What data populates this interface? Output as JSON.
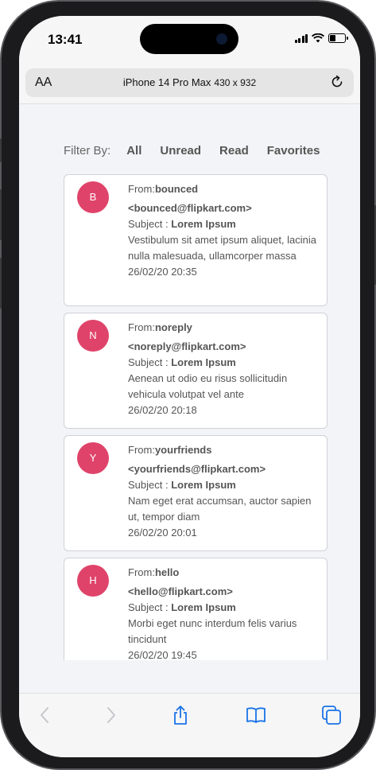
{
  "status": {
    "time": "13:41"
  },
  "browser": {
    "text_size_label": "AA",
    "device_name": "iPhone 14 Pro Max",
    "device_dims": "430 x 932"
  },
  "filter": {
    "label": "Filter By:",
    "options": [
      "All",
      "Unread",
      "Read",
      "Favorites"
    ]
  },
  "emails": [
    {
      "initial": "B",
      "from_prefix": "From:",
      "from_name": "bounced",
      "from_email": "<bounced@flipkart.com>",
      "subject_prefix": "Subject : ",
      "subject": "Lorem Ipsum",
      "body": "Vestibulum sit amet ipsum aliquet, lacinia nulla malesuada, ullamcorper massa",
      "date": "26/02/20 20:35"
    },
    {
      "initial": "N",
      "from_prefix": "From:",
      "from_name": "noreply",
      "from_email": "<noreply@flipkart.com>",
      "subject_prefix": "Subject : ",
      "subject": "Lorem Ipsum",
      "body": "Aenean ut odio eu risus sollicitudin vehicula volutpat vel ante",
      "date": "26/02/20 20:18"
    },
    {
      "initial": "Y",
      "from_prefix": "From:",
      "from_name": "yourfriends",
      "from_email": "<yourfriends@flipkart.com>",
      "subject_prefix": "Subject : ",
      "subject": "Lorem Ipsum",
      "body": "Nam eget erat accumsan, auctor sapien ut, tempor diam",
      "date": "26/02/20 20:01"
    },
    {
      "initial": "H",
      "from_prefix": "From:",
      "from_name": "hello",
      "from_email": "<hello@flipkart.com>",
      "subject_prefix": "Subject : ",
      "subject": "Lorem Ipsum",
      "body": "Morbi eget nunc interdum felis varius tincidunt",
      "date": "26/02/20 19:45"
    }
  ],
  "colors": {
    "avatar": "#e0436a",
    "accent_ios": "#1a73e8"
  },
  "toolbar": {
    "icons": [
      "back-icon",
      "forward-icon",
      "share-icon",
      "bookmarks-icon",
      "tabs-icon"
    ]
  }
}
